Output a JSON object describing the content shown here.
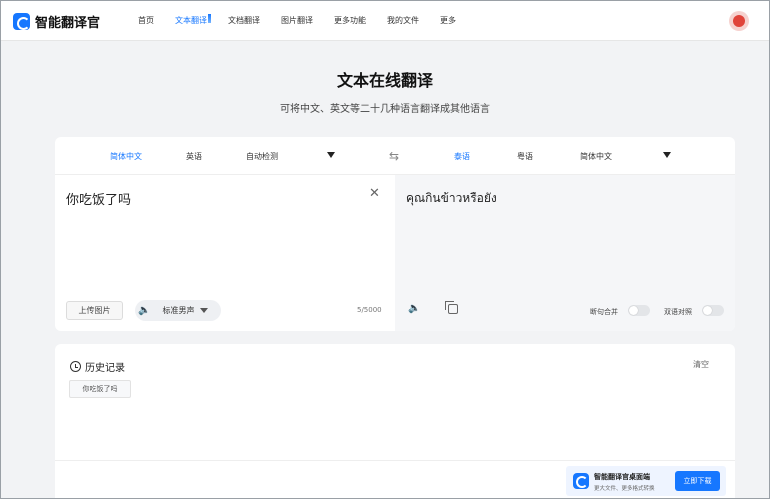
{
  "header": {
    "logo_text": "智能翻译官",
    "nav": [
      "首页",
      "文本翻译",
      "文档翻译",
      "图片翻译",
      "更多功能",
      "我的文件",
      "更多"
    ],
    "active_index": 1
  },
  "hero": {
    "title": "文本在线翻译",
    "subtitle": "可将中文、英文等二十几种语言翻译成其他语言"
  },
  "source_langs": [
    "简体中文",
    "英语",
    "自动检测"
  ],
  "target_langs": [
    "泰语",
    "粤语",
    "简体中文"
  ],
  "source": {
    "text": "你吃饭了吗",
    "upload_label": "上传图片",
    "voice_label": "标准男声",
    "char_count": "5/5000"
  },
  "target": {
    "text": "คุณกินข้าวหรือยัง",
    "toggle_merge_label": "断句合并",
    "toggle_bilingual_label": "双语对照"
  },
  "history": {
    "title": "历史记录",
    "clear_label": "清空",
    "items": [
      "你吃饭了吗"
    ]
  },
  "banner": {
    "title": "智能翻译官桌面端",
    "subtitle": "更大文件、更多格式转换",
    "button": "立即下载"
  },
  "colors": {
    "accent": "#1677ff",
    "page_bg": "#f2f3f5"
  },
  "icons": [
    "logo-icon",
    "avatar-icon",
    "swap-icon",
    "close-icon",
    "speaker-icon",
    "copy-icon",
    "history-clock-icon"
  ]
}
